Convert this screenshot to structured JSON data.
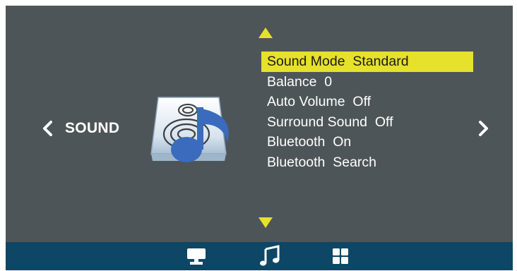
{
  "section": {
    "title": "SOUND",
    "icon": "speaker-music-note-icon"
  },
  "menu": {
    "items": [
      {
        "label": "Sound Mode  Standard",
        "selected": true
      },
      {
        "label": "Balance  0",
        "selected": false
      },
      {
        "label": "Auto Volume  Off",
        "selected": false
      },
      {
        "label": "Surround Sound  Off",
        "selected": false
      },
      {
        "label": "Bluetooth  On",
        "selected": false
      },
      {
        "label": "Bluetooth  Search",
        "selected": false
      }
    ]
  },
  "tabs": [
    {
      "icon": "monitor-icon",
      "active": false
    },
    {
      "icon": "music-note-icon",
      "active": true
    },
    {
      "icon": "grid-icon",
      "active": false
    }
  ],
  "colors": {
    "background": "#4e5559",
    "highlight": "#e6e12a",
    "bottom_bar": "#0e4665",
    "text": "#ffffff"
  }
}
